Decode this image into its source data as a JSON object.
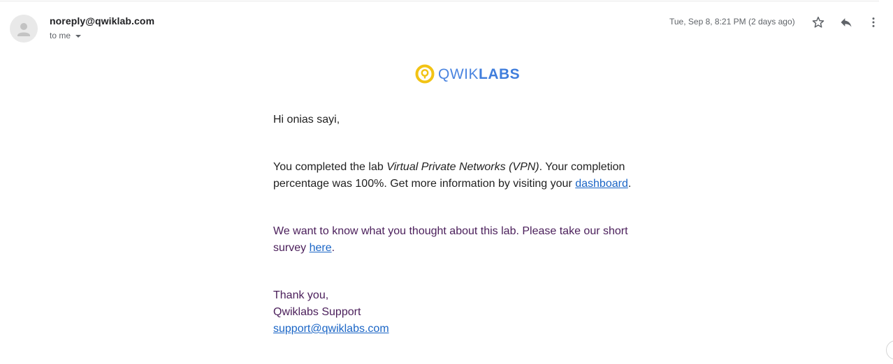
{
  "header": {
    "sender": "noreply@qwiklab.com",
    "recipient_label": "to me",
    "timestamp": "Tue, Sep 8, 8:21 PM (2 days ago)"
  },
  "icons": {
    "avatar": "person-icon",
    "recipient_toggle": "chevron-down-icon",
    "star": "star-icon",
    "reply": "reply-icon",
    "more": "more-vert-icon",
    "logo": "qwiklabs-logo"
  },
  "logo": {
    "part1": "QWIK",
    "part2": "LABS"
  },
  "body": {
    "greeting": "Hi onias sayi,",
    "completed_prefix": "You completed the lab ",
    "lab_name": "Virtual Private Networks (VPN)",
    "completed_middle": ". Your completion percentage was 100%. Get more information by visiting your ",
    "dashboard_link": "dashboard",
    "completed_suffix": ".",
    "survey_prefix": "We want to know what you thought about this lab. Please take our short survey ",
    "survey_link": "here",
    "survey_suffix": ".",
    "thanks": "Thank you,",
    "team": "Qwiklabs Support",
    "support_email": "support@qwiklabs.com"
  },
  "colors": {
    "body_text": "#222222",
    "quoted_text": "#4a1e5a",
    "link": "#1a65c6",
    "logo_blue": "#4a84e0",
    "logo_yellow": "#f2c314"
  }
}
